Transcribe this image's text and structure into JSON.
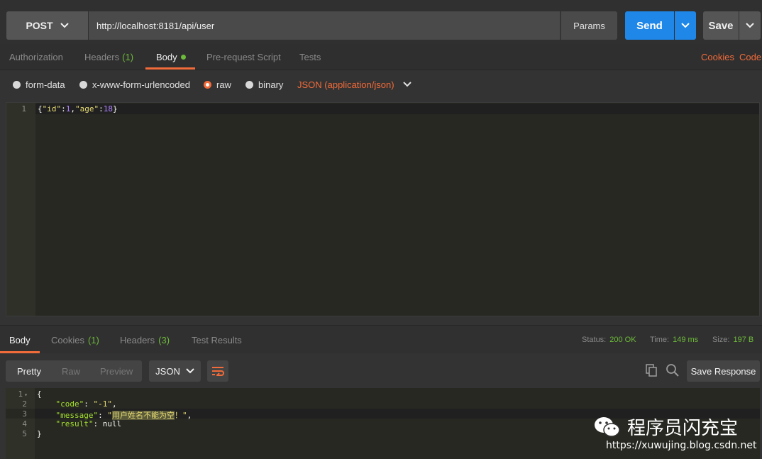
{
  "request": {
    "method": "POST",
    "url": "http://localhost:8181/api/user",
    "params_label": "Params",
    "send_label": "Send",
    "save_label": "Save"
  },
  "request_tabs": {
    "authorization": "Authorization",
    "headers": "Headers",
    "headers_count": "(1)",
    "body": "Body",
    "prerequest": "Pre-request Script",
    "tests": "Tests",
    "cookies": "Cookies",
    "code": "Code"
  },
  "body_types": {
    "form_data": "form-data",
    "urlencoded": "x-www-form-urlencoded",
    "raw": "raw",
    "binary": "binary",
    "content_type": "JSON (application/json)",
    "selected": "raw"
  },
  "request_editor": {
    "line_number": "1",
    "brace_open": "{",
    "key_id": "\"id\"",
    "colon": ":",
    "val_id": "1",
    "comma": ",",
    "key_age": "\"age\"",
    "val_age": "18",
    "brace_close": "}"
  },
  "response_tabs": {
    "body": "Body",
    "cookies": "Cookies",
    "cookies_count": "(1)",
    "headers": "Headers",
    "headers_count": "(3)",
    "test_results": "Test Results"
  },
  "response_status": {
    "status_label": "Status:",
    "status_value": "200 OK",
    "time_label": "Time:",
    "time_value": "149 ms",
    "size_label": "Size:",
    "size_value": "197 B"
  },
  "response_toolbar": {
    "pretty": "Pretty",
    "raw": "Raw",
    "preview": "Preview",
    "format": "JSON",
    "save_response": "Save Response"
  },
  "response_editor": {
    "lines": [
      "1",
      "2",
      "3",
      "4",
      "5"
    ],
    "open": "{",
    "code_key": "\"code\"",
    "code_val": "\"-1\"",
    "message_key": "\"message\"",
    "message_q": "\"",
    "message_hl": "用户姓名不能为空",
    "message_tail": "！\"",
    "result_key": "\"result\"",
    "result_val": "null",
    "close": "}"
  },
  "watermark": {
    "title": "程序员闪充宝",
    "url": "https://xuwujing.blog.csdn.net"
  },
  "colors": {
    "accent": "#f26b3a",
    "send_blue": "#1f87e8",
    "green": "#6dbb3a"
  }
}
